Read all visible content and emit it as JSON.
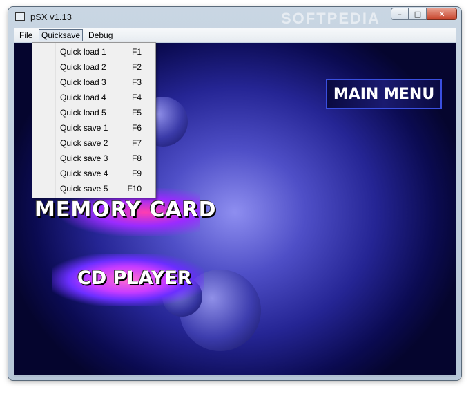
{
  "window": {
    "title": "pSX v1.13",
    "watermark": "SOFTPEDIA"
  },
  "caption": {
    "minimize": "–",
    "maximize": "□",
    "close": "✕"
  },
  "menubar": {
    "items": [
      "File",
      "Quicksave",
      "Debug"
    ]
  },
  "dropdown": {
    "items": [
      {
        "label": "Quick load 1",
        "key": "F1"
      },
      {
        "label": "Quick load 2",
        "key": "F2"
      },
      {
        "label": "Quick load 3",
        "key": "F3"
      },
      {
        "label": "Quick load 4",
        "key": "F4"
      },
      {
        "label": "Quick load 5",
        "key": "F5"
      },
      {
        "label": "Quick save 1",
        "key": "F6"
      },
      {
        "label": "Quick save 2",
        "key": "F7"
      },
      {
        "label": "Quick save 3",
        "key": "F8"
      },
      {
        "label": "Quick save 4",
        "key": "F9"
      },
      {
        "label": "Quick save 5",
        "key": "F10"
      }
    ]
  },
  "screen": {
    "main_menu": "MAIN MENU",
    "memory_card": "MEMORY CARD",
    "cd_player": "CD PLAYER"
  },
  "colors": {
    "accent_border": "#3a4fe0",
    "bg_center": "#8e8ef0",
    "bg_edge": "#05052e"
  }
}
